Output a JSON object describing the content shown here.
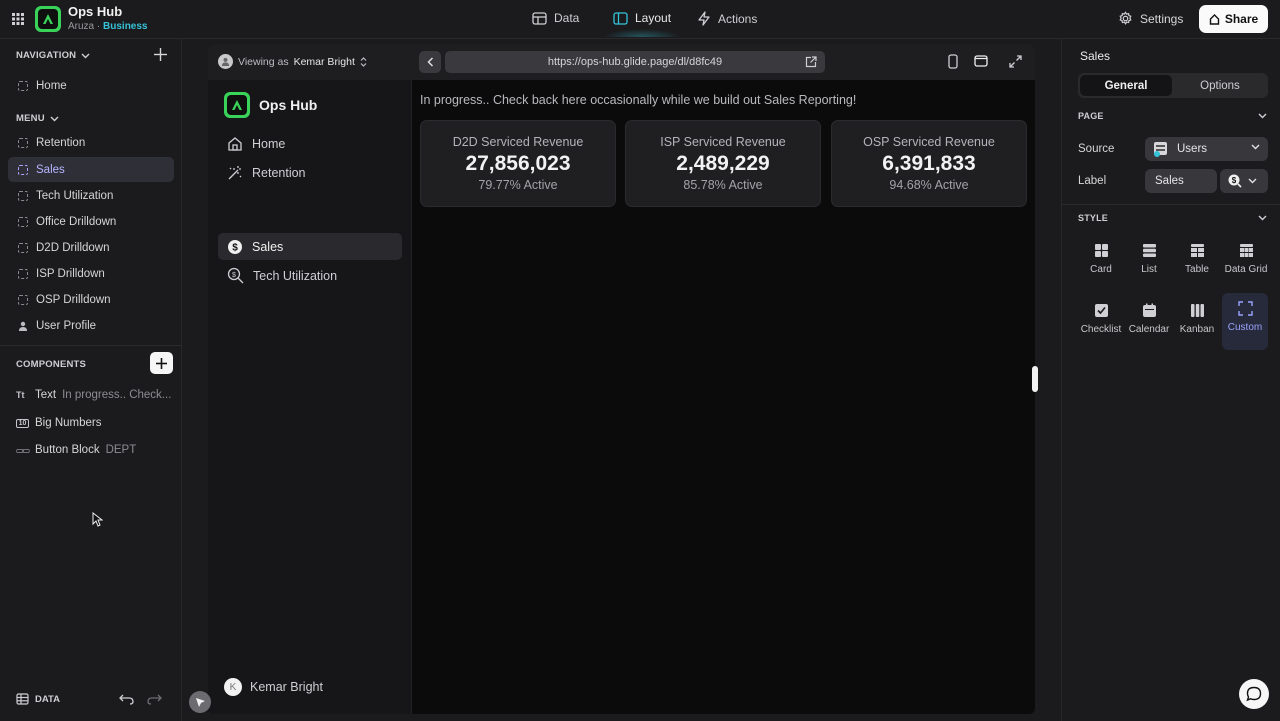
{
  "app": {
    "name": "Ops Hub",
    "org": "Aruza",
    "separator": "·",
    "plan": "Business"
  },
  "top_tabs": [
    {
      "label": "Data",
      "icon": "table-icon"
    },
    {
      "label": "Layout",
      "icon": "layout-icon",
      "active": true
    },
    {
      "label": "Actions",
      "icon": "lightning-icon"
    }
  ],
  "top_right": {
    "settings": "Settings",
    "share": "Share"
  },
  "sidebar": {
    "navigation_label": "NAVIGATION",
    "navigation_items": [
      "Home"
    ],
    "menu_label": "MENU",
    "menu_items": [
      "Retention",
      "Sales",
      "Tech Utilization",
      "Office Drilldown",
      "D2D Drilldown",
      "ISP Drilldown",
      "OSP Drilldown",
      "User Profile"
    ],
    "menu_active": "Sales",
    "components_label": "COMPONENTS",
    "components": [
      {
        "icon_text": "Tt",
        "name": "Text",
        "hint": "In progress.. Check..."
      },
      {
        "icon_text": "10",
        "name": "Big Numbers",
        "hint": ""
      },
      {
        "icon_text": "▭▭",
        "name": "Button Block",
        "hint": "DEPT"
      }
    ],
    "bottom_data": "DATA"
  },
  "preview": {
    "viewing_prefix": "Viewing as",
    "viewing_user": "Kemar Bright",
    "url": "https://ops-hub.glide.page/dl/d8fc49",
    "app_title": "Ops Hub",
    "nav": [
      {
        "label": "Home",
        "icon": "home-icon"
      },
      {
        "label": "Retention",
        "icon": "wand-icon"
      },
      {
        "label": "Sales",
        "icon": "dollar-icon",
        "active": true
      },
      {
        "label": "Tech Utilization",
        "icon": "magnify-dollar-icon"
      }
    ],
    "user_initial": "K",
    "user_name": "Kemar Bright",
    "progress_text": "In progress.. Check back here occasionally while we build out Sales Reporting!",
    "cards": [
      {
        "title": "D2D Serviced Revenue",
        "value": "27,856,023",
        "sub": "79.77% Active"
      },
      {
        "title": "ISP Serviced Revenue",
        "value": "2,489,229",
        "sub": "85.78% Active"
      },
      {
        "title": "OSP Serviced Revenue",
        "value": "6,391,833",
        "sub": "94.68% Active"
      }
    ]
  },
  "right_panel": {
    "title": "Sales",
    "tabs": [
      "General",
      "Options"
    ],
    "active_tab": "General",
    "page_label": "PAGE",
    "source_label": "Source",
    "source_value": "Users",
    "label_label": "Label",
    "label_value": "Sales",
    "style_label": "STYLE",
    "styles": [
      "Card",
      "List",
      "Table",
      "Data Grid",
      "Checklist",
      "Calendar",
      "Kanban",
      "Custom"
    ],
    "active_style": "Custom"
  },
  "colors": {
    "accent": "#36c3d8",
    "brand_green": "#3ad35a",
    "active_purple": "#b7b4ff"
  }
}
